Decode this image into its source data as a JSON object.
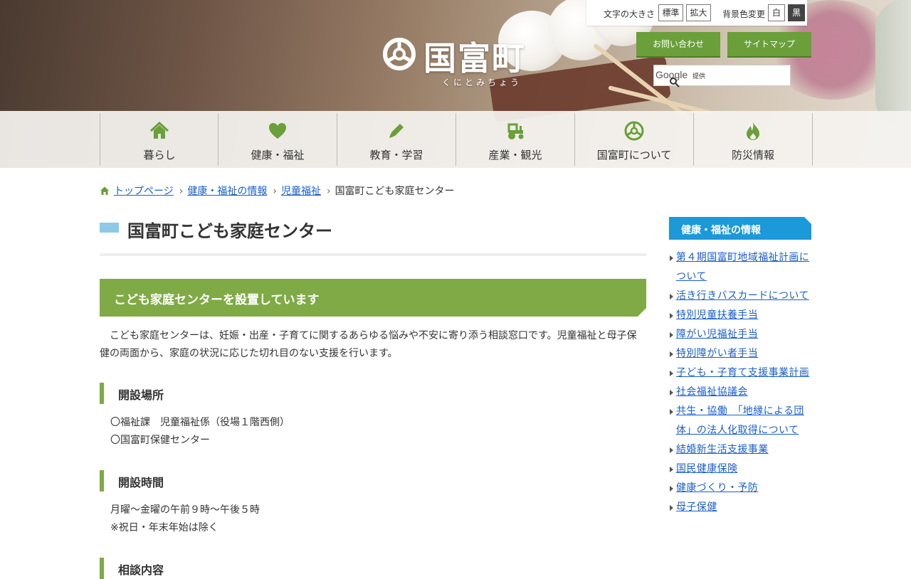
{
  "header": {
    "logo": {
      "name": "国富町",
      "kana": "くにとみちょう",
      "icon": "town-emblem-icon"
    },
    "accessibility": {
      "font_size_label": "文字の大きさ",
      "standard_label": "標準",
      "large_label": "拡大",
      "bg_color_label": "背景色変更",
      "white_label": "白",
      "black_label": "黒"
    },
    "contact_label": "お問い合わせ",
    "sitemap_label": "サイトマップ",
    "search": {
      "brand": "Google",
      "provided_label": "提供",
      "placeholder": ""
    },
    "accent_color": "#6a9f3a"
  },
  "nav": [
    {
      "label": "暮らし",
      "icon": "home-icon"
    },
    {
      "label": "健康・福祉",
      "icon": "heart-icon"
    },
    {
      "label": "教育・学習",
      "icon": "pencil-icon"
    },
    {
      "label": "産業・観光",
      "icon": "tractor-icon"
    },
    {
      "label": "国富町について",
      "icon": "town-emblem-icon"
    },
    {
      "label": "防災情報",
      "icon": "flame-icon"
    }
  ],
  "breadcrumb": [
    {
      "label": "トップページ",
      "link": true
    },
    {
      "label": "健康・福祉の情報",
      "link": true
    },
    {
      "label": "児童福祉",
      "link": true
    },
    {
      "label": "国富町こども家庭センター",
      "link": false
    }
  ],
  "main": {
    "title": "国富町こども家庭センター",
    "section_heading": "こども家庭センターを設置しています",
    "intro": "　こども家庭センターは、妊娠・出産・子育てに関するあらゆる悩みや不安に寄り添う相談窓口です。児童福祉と母子保健の両面から、家庭の状況に応じた切れ目のない支援を行います。",
    "subsections": [
      {
        "heading": "開設場所",
        "lines": [
          "〇福祉課　児童福祉係（役場１階西側）",
          "〇国富町保健センター"
        ]
      },
      {
        "heading": "開設時間",
        "lines": [
          "月曜～金曜の午前９時～午後５時",
          "※祝日・年末年始は除く"
        ]
      },
      {
        "heading": "相談内容",
        "lines": []
      }
    ],
    "accent_color": "#7faa45"
  },
  "sidebar": {
    "heading": "健康・福祉の情報",
    "heading_color": "#1b99d9",
    "items": [
      "第４期国富町地域福祉計画について",
      "活き行きバスカードについて",
      "特別児童扶養手当",
      "障がい児福祉手当",
      "特別障がい者手当",
      "子ども・子育て支援事業計画",
      "社会福祉協議会",
      "共生・協働　「地縁による団体」の法人化取得について",
      "結婚新生活支援事業",
      "国民健康保険",
      "健康づくり・予防",
      "母子保健"
    ]
  }
}
